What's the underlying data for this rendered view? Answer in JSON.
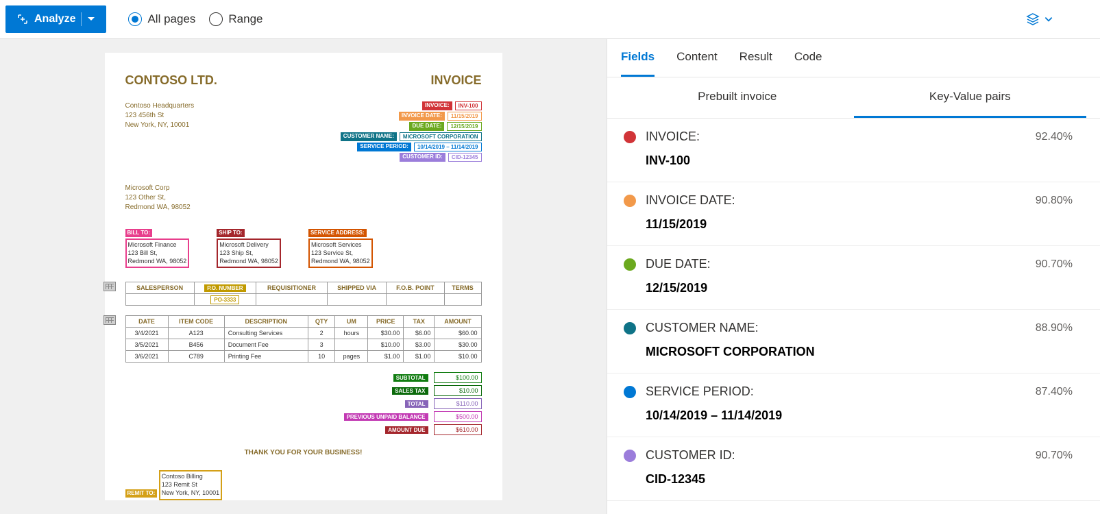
{
  "toolbar": {
    "analyze": "Analyze",
    "allPages": "All pages",
    "range": "Range"
  },
  "doc": {
    "company": "CONTOSO LTD.",
    "title": "INVOICE",
    "hq": {
      "l1": "Contoso Headquarters",
      "l2": "123 456th St",
      "l3": "New York, NY, 10001"
    },
    "meta": {
      "invNoLbl": "INVOICE:",
      "invNo": "INV-100",
      "invDateLbl": "INVOICE DATE:",
      "invDate": "11/15/2019",
      "dueLbl": "DUE DATE:",
      "due": "12/15/2019",
      "custLbl": "CUSTOMER NAME:",
      "cust": "MICROSOFT CORPORATION",
      "svcLbl": "SERVICE PERIOD:",
      "svc": "10/14/2019 – 11/14/2019",
      "cidLbl": "CUSTOMER ID:",
      "cid": "CID-12345"
    },
    "cust": {
      "l1": "Microsoft Corp",
      "l2": "123 Other St,",
      "l3": "Redmond WA, 98052"
    },
    "billLbl": "BILL TO:",
    "bill": {
      "l1": "Microsoft Finance",
      "l2": "123 Bill St,",
      "l3": "Redmond WA, 98052"
    },
    "shipLbl": "SHIP TO:",
    "ship": {
      "l1": "Microsoft Delivery",
      "l2": "123 Ship St,",
      "l3": "Redmond WA, 98052"
    },
    "svcAddrLbl": "SERVICE ADDRESS:",
    "svcAddr": {
      "l1": "Microsoft Services",
      "l2": "123 Service St,",
      "l3": "Redmond WA, 98052"
    },
    "t1": {
      "salesperson": "SALESPERSON",
      "po": "P.O. NUMBER",
      "req": "REQUISITIONER",
      "ship": "SHIPPED VIA",
      "fob": "F.O.B. POINT",
      "terms": "TERMS",
      "poVal": "PO-3333"
    },
    "t2h": {
      "date": "DATE",
      "code": "ITEM CODE",
      "desc": "DESCRIPTION",
      "qty": "QTY",
      "um": "UM",
      "price": "PRICE",
      "tax": "TAX",
      "amount": "AMOUNT"
    },
    "t2r": [
      {
        "date": "3/4/2021",
        "code": "A123",
        "desc": "Consulting Services",
        "qty": "2",
        "um": "hours",
        "price": "$30.00",
        "tax": "$6.00",
        "amount": "$60.00"
      },
      {
        "date": "3/5/2021",
        "code": "B456",
        "desc": "Document Fee",
        "qty": "3",
        "um": "",
        "price": "$10.00",
        "tax": "$3.00",
        "amount": "$30.00"
      },
      {
        "date": "3/6/2021",
        "code": "C789",
        "desc": "Printing Fee",
        "qty": "10",
        "um": "pages",
        "price": "$1.00",
        "tax": "$1.00",
        "amount": "$10.00"
      }
    ],
    "totals": {
      "subLbl": "SUBTOTAL",
      "sub": "$100.00",
      "taxLbl": "SALES TAX",
      "tax": "$10.00",
      "totLbl": "TOTAL",
      "tot": "$110.00",
      "prevLbl": "PREVIOUS UNPAID BALANCE",
      "prev": "$500.00",
      "dueLbl": "AMOUNT DUE",
      "due": "$610.00"
    },
    "thanks": "THANK YOU FOR YOUR BUSINESS!",
    "remitLbl": "REMIT TO:",
    "remit": {
      "l1": "Contoso Billing",
      "l2": "123 Remit St",
      "l3": "New York, NY, 10001"
    }
  },
  "panel": {
    "tabs": {
      "fields": "Fields",
      "content": "Content",
      "result": "Result",
      "code": "Code"
    },
    "subtabs": {
      "prebuilt": "Prebuilt invoice",
      "kv": "Key-Value pairs"
    }
  },
  "fields": [
    {
      "color": "#d13438",
      "key": "INVOICE:",
      "conf": "92.40%",
      "val": "INV-100"
    },
    {
      "color": "#f2994a",
      "key": "INVOICE DATE:",
      "conf": "90.80%",
      "val": "11/15/2019"
    },
    {
      "color": "#6ba91e",
      "key": "DUE DATE:",
      "conf": "90.70%",
      "val": "12/15/2019"
    },
    {
      "color": "#0f7387",
      "key": "CUSTOMER NAME:",
      "conf": "88.90%",
      "val": "MICROSOFT CORPORATION"
    },
    {
      "color": "#0078d4",
      "key": "SERVICE PERIOD:",
      "conf": "87.40%",
      "val": "10/14/2019 – 11/14/2019"
    },
    {
      "color": "#9b7ddb",
      "key": "CUSTOMER ID:",
      "conf": "90.70%",
      "val": "CID-12345"
    }
  ]
}
